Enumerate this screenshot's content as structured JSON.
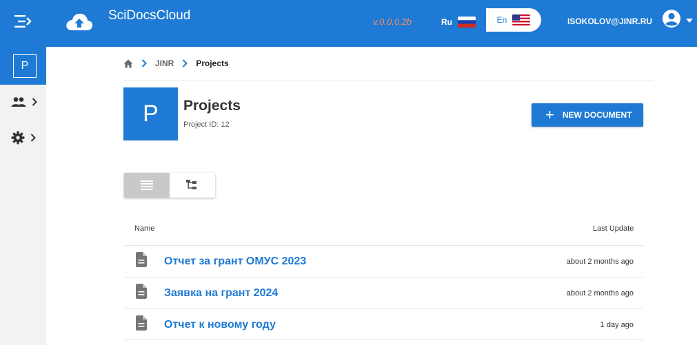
{
  "app": {
    "title": "SciDocsCloud",
    "version": "v.0.0.0.2b",
    "brand_color": "#1e7ad4"
  },
  "topbar": {
    "lang_ru": "Ru",
    "lang_en": "En",
    "user_email": "ISOKOLOV@JINR.RU"
  },
  "rail": {
    "active_badge": "P"
  },
  "breadcrumb": {
    "items": [
      "JINR",
      "Projects"
    ]
  },
  "project": {
    "avatar_letter": "P",
    "title": "Projects",
    "id_text": "Project ID: 12"
  },
  "actions": {
    "new_document": "NEW DOCUMENT"
  },
  "table": {
    "col_name": "Name",
    "col_updated": "Last Update",
    "rows": [
      {
        "name": "Отчет за грант ОМУС 2023",
        "updated": "about 2 months ago"
      },
      {
        "name": "Заявка на грант 2024",
        "updated": "about 2 months ago"
      },
      {
        "name": "Отчет к новому году",
        "updated": "1 day ago"
      }
    ]
  }
}
